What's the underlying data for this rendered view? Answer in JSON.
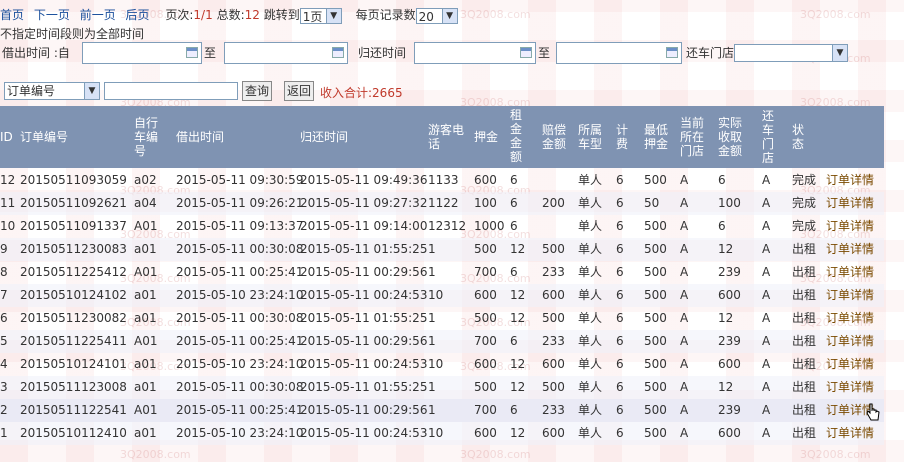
{
  "pager": {
    "first": "首页",
    "next": "下一页",
    "prev": "前一页",
    "last": "后页",
    "page_label": "页次:",
    "page_value": "1/1",
    "total_label": "总数:",
    "total_value": "12",
    "jump_label": "跳转到",
    "jump_value": "1页",
    "per_page_label": "每页记录数",
    "per_page_value": "20"
  },
  "note": "不指定时间段则为全部时间",
  "filters": {
    "borrow_label": "借出时间 :自",
    "to1": "至",
    "return_label": "归还时间",
    "to2": "至",
    "store_label": "还车门店",
    "search_field": "订单编号",
    "query_button": "查询",
    "back_button": "返回",
    "income": "收入合计:2665"
  },
  "columns": [
    "ID",
    "订单编号",
    "自行车编号",
    "借出时间",
    "归还时间",
    "游客电话",
    "押金",
    "租金金额",
    "赔偿金额",
    "所属车型",
    "计费",
    "最低押金",
    "当前所在门店",
    "实际收取金额",
    "还车门店",
    "状态"
  ],
  "rows": [
    [
      "12",
      "20150511093059",
      "a02",
      "2015-05-11 09:30:59",
      "2015-05-11 09:49:36",
      "1133",
      "600",
      "6",
      "",
      "单人",
      "6",
      "500",
      "A",
      "6",
      "A",
      "完成",
      "订单详情"
    ],
    [
      "11",
      "20150511092621",
      "a04",
      "2015-05-11 09:26:21",
      "2015-05-11 09:27:32",
      "1122",
      "100",
      "6",
      "200",
      "单人",
      "6",
      "50",
      "A",
      "100",
      "A",
      "完成",
      "订单详情"
    ],
    [
      "10",
      "20150511091337",
      "A01",
      "2015-05-11 09:13:37",
      "2015-05-11 09:14:00",
      "12312",
      "1000",
      "6",
      "",
      "单人",
      "6",
      "500",
      "A",
      "6",
      "A",
      "完成",
      "订单详情"
    ],
    [
      "9",
      "20150511230083",
      "a01",
      "2015-05-11 00:30:08",
      "2015-05-11 01:55:25",
      "1",
      "500",
      "12",
      "500",
      "单人",
      "6",
      "500",
      "A",
      "12",
      "A",
      "出租",
      "订单详情"
    ],
    [
      "8",
      "20150511225412",
      "A01",
      "2015-05-11 00:25:41",
      "2015-05-11 00:29:56",
      "1",
      "700",
      "6",
      "233",
      "单人",
      "6",
      "500",
      "A",
      "239",
      "A",
      "出租",
      "订单详情"
    ],
    [
      "7",
      "20150510124102",
      "a01",
      "2015-05-10 23:24:10",
      "2015-05-11 00:24:53",
      "10",
      "600",
      "12",
      "600",
      "单人",
      "6",
      "500",
      "A",
      "600",
      "A",
      "出租",
      "订单详情"
    ],
    [
      "6",
      "20150511230082",
      "a01",
      "2015-05-11 00:30:08",
      "2015-05-11 01:55:25",
      "1",
      "500",
      "12",
      "500",
      "单人",
      "6",
      "500",
      "A",
      "12",
      "A",
      "出租",
      "订单详情"
    ],
    [
      "5",
      "20150511225411",
      "A01",
      "2015-05-11 00:25:41",
      "2015-05-11 00:29:56",
      "1",
      "700",
      "6",
      "233",
      "单人",
      "6",
      "500",
      "A",
      "239",
      "A",
      "出租",
      "订单详情"
    ],
    [
      "4",
      "20150510124101",
      "a01",
      "2015-05-10 23:24:10",
      "2015-05-11 00:24:53",
      "10",
      "600",
      "12",
      "600",
      "单人",
      "6",
      "500",
      "A",
      "600",
      "A",
      "出租",
      "订单详情"
    ],
    [
      "3",
      "20150511123008",
      "a01",
      "2015-05-11 00:30:08",
      "2015-05-11 01:55:25",
      "1",
      "500",
      "12",
      "500",
      "单人",
      "6",
      "500",
      "A",
      "12",
      "A",
      "出租",
      "订单详情"
    ],
    [
      "2",
      "20150511122541",
      "A01",
      "2015-05-11 00:25:41",
      "2015-05-11 00:29:56",
      "1",
      "700",
      "6",
      "233",
      "单人",
      "6",
      "500",
      "A",
      "239",
      "A",
      "出租",
      "订单详情"
    ],
    [
      "1",
      "20150510112410",
      "a01",
      "2015-05-10 23:24:10",
      "2015-05-11 00:24:53",
      "10",
      "600",
      "12",
      "600",
      "单人",
      "6",
      "500",
      "A",
      "600",
      "A",
      "出租",
      "订单详情"
    ]
  ],
  "watermark": "3Q2008.com",
  "colors": {
    "header_bg": "#7f93b2",
    "link": "#1a4f9c",
    "accent_red": "#c0392b"
  }
}
